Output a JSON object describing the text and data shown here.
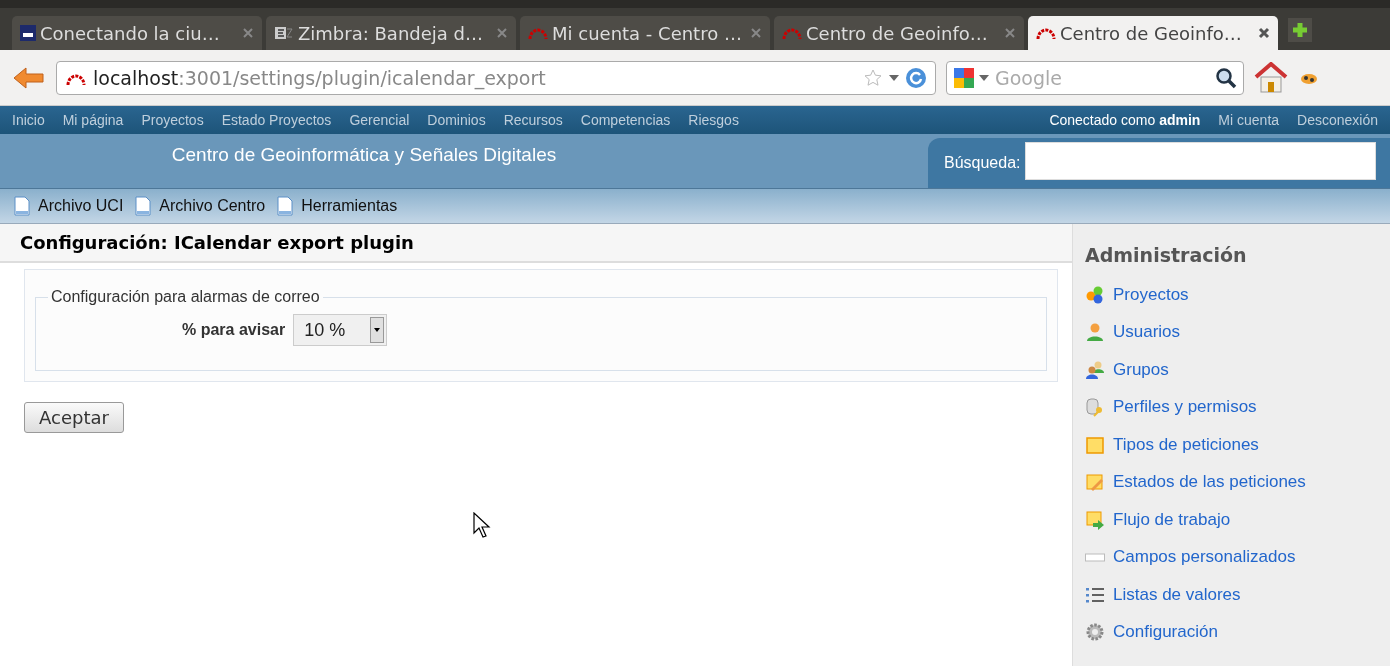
{
  "browser": {
    "tabs": [
      {
        "title": "Conectando la ciu…",
        "selected": false
      },
      {
        "title": "Zimbra: Bandeja d…",
        "selected": false
      },
      {
        "title": "Mi cuenta - Centro …",
        "selected": false
      },
      {
        "title": "Centro de Geoinfo…",
        "selected": false
      },
      {
        "title": "Centro de Geoinfo…",
        "selected": true
      }
    ],
    "url_host": "localhost",
    "url_path": ":3001/settings/plugin/icalendar_export",
    "search_placeholder": "Google"
  },
  "top_menu": {
    "items": [
      "Inicio",
      "Mi página",
      "Proyectos",
      "Estado Proyectos",
      "Gerencial",
      "Dominios",
      "Recursos",
      "Competencias",
      "Riesgos"
    ],
    "logged_in": "Conectado como **admin**",
    "account_items": [
      "Mi cuenta",
      "Desconexión"
    ]
  },
  "header": {
    "title": "Centro de Geoinformática y Señales Digitales",
    "search_label": "Búsqueda:"
  },
  "main_menu": [
    "Archivo UCI",
    "Archivo Centro",
    "Herramientas"
  ],
  "content": {
    "title": "Configuración: ICalendar export plugin",
    "fieldset_legend": "Configuración para alarmas de correo",
    "field_label": "% para avisar",
    "field_value": "10 %",
    "submit": "Aceptar"
  },
  "sidebar": {
    "title": "Administración",
    "items": [
      {
        "label": "Proyectos"
      },
      {
        "label": "Usuarios"
      },
      {
        "label": "Grupos"
      },
      {
        "label": "Perfiles y permisos"
      },
      {
        "label": "Tipos de peticiones"
      },
      {
        "label": "Estados de las peticiones"
      },
      {
        "label": "Flujo de trabajo"
      },
      {
        "label": "Campos personalizados"
      },
      {
        "label": "Listas de valores"
      },
      {
        "label": "Configuración"
      }
    ]
  }
}
